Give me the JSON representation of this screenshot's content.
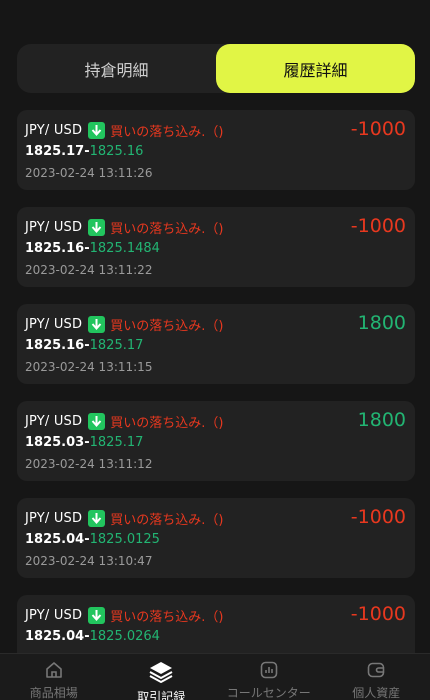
{
  "tabs": [
    {
      "label": "持倉明細",
      "active": false
    },
    {
      "label": "履歴詳細",
      "active": true
    }
  ],
  "colors": {
    "accent": "#e1f545",
    "up": "#22b573",
    "down": "#e8381f",
    "card": "#222222",
    "bg": "#161616"
  },
  "records": [
    {
      "pair": "JPY/ USD",
      "direction": "買いの落ち込み.（)",
      "amount": "-1000",
      "open": "1825.17",
      "close": "1825.16",
      "time": "2023-02-24 13:11:26",
      "profit": false
    },
    {
      "pair": "JPY/ USD",
      "direction": "買いの落ち込み.（)",
      "amount": "-1000",
      "open": "1825.16",
      "close": "1825.1484",
      "time": "2023-02-24 13:11:22",
      "profit": false
    },
    {
      "pair": "JPY/ USD",
      "direction": "買いの落ち込み.（)",
      "amount": "1800",
      "open": "1825.16",
      "close": "1825.17",
      "time": "2023-02-24 13:11:15",
      "profit": true
    },
    {
      "pair": "JPY/ USD",
      "direction": "買いの落ち込み.（)",
      "amount": "1800",
      "open": "1825.03",
      "close": "1825.17",
      "time": "2023-02-24 13:11:12",
      "profit": true
    },
    {
      "pair": "JPY/ USD",
      "direction": "買いの落ち込み.（)",
      "amount": "-1000",
      "open": "1825.04",
      "close": "1825.0125",
      "time": "2023-02-24 13:10:47",
      "profit": false
    },
    {
      "pair": "JPY/ USD",
      "direction": "買いの落ち込み.（)",
      "amount": "-1000",
      "open": "1825.04",
      "close": "1825.0264",
      "time": "",
      "profit": false
    }
  ],
  "arrow_icon": "arrow-down-icon",
  "nav": [
    {
      "label": "商品相場",
      "icon": "home-icon",
      "active": false
    },
    {
      "label": "取引記録",
      "icon": "layers-icon",
      "active": true
    },
    {
      "label": "コールセンター",
      "icon": "chart-icon",
      "active": false
    },
    {
      "label": "個人資産",
      "icon": "wallet-icon",
      "active": false
    }
  ]
}
